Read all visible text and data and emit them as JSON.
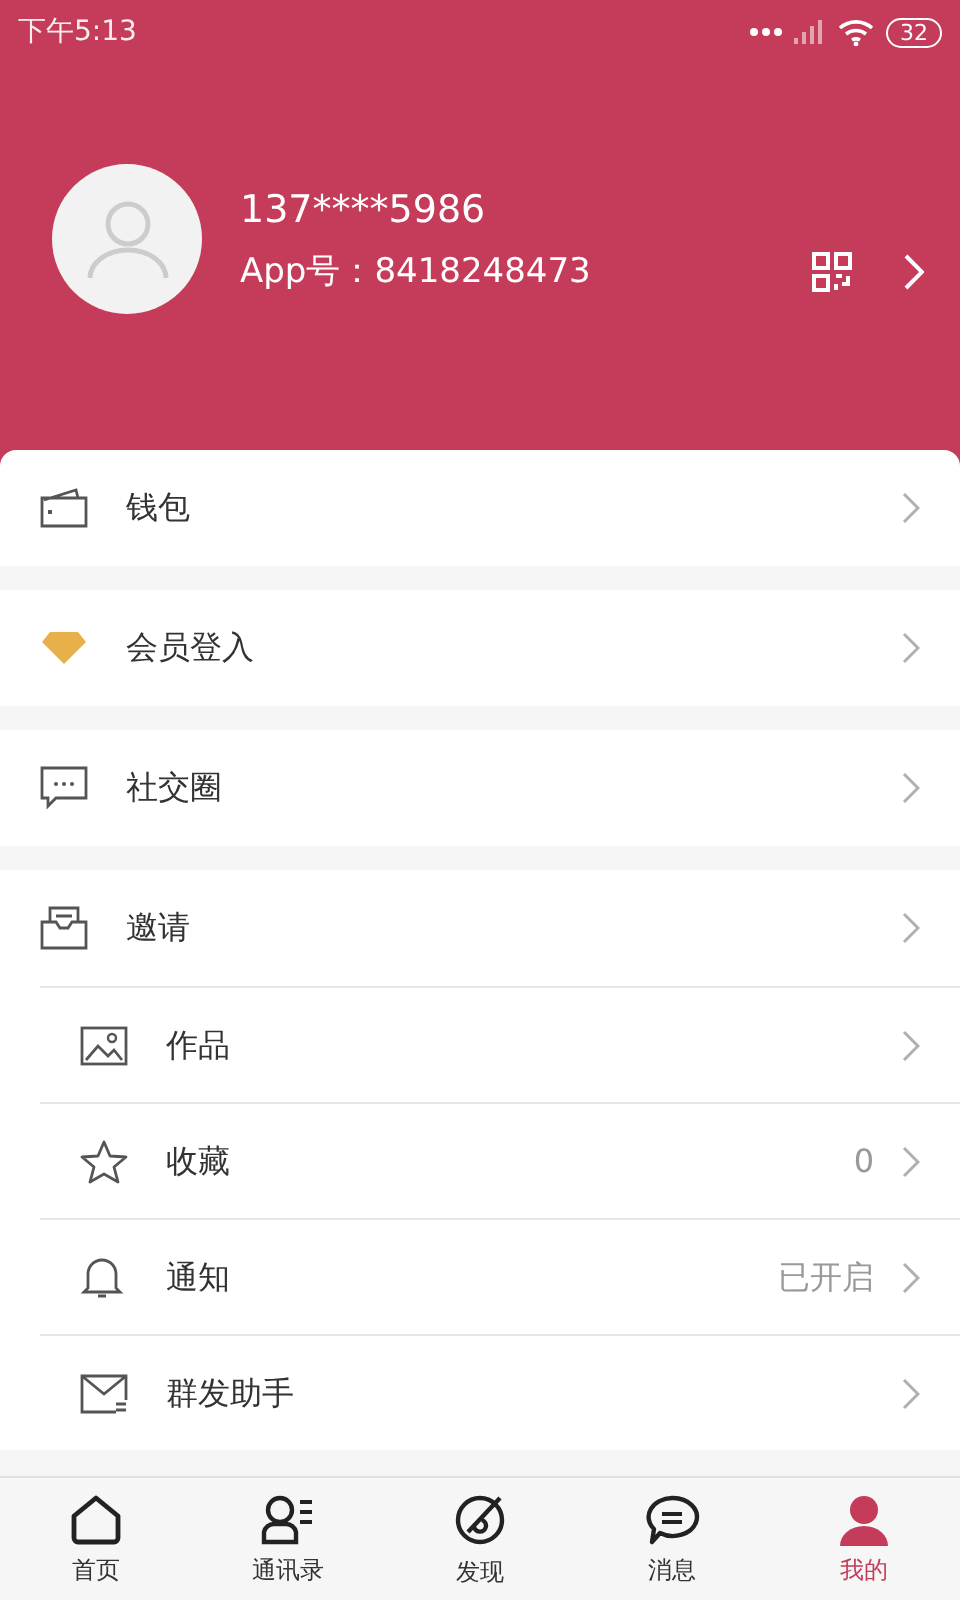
{
  "status_bar": {
    "time": "下午5:13",
    "battery": "32"
  },
  "profile": {
    "phone": "137****5986",
    "app_id": "App号：8418248473"
  },
  "groups": [
    {
      "items": [
        {
          "label": "钱包"
        }
      ]
    },
    {
      "items": [
        {
          "label": "会员登入"
        }
      ]
    },
    {
      "items": [
        {
          "label": "社交圈"
        }
      ]
    },
    {
      "items": [
        {
          "label": "邀请"
        },
        {
          "label": "作品"
        },
        {
          "label": "收藏",
          "value": "0"
        },
        {
          "label": "通知",
          "value": "已开启"
        },
        {
          "label": "群发助手"
        }
      ]
    }
  ],
  "tab_bar": [
    {
      "label": "首页",
      "selected": false
    },
    {
      "label": "通讯录",
      "selected": false
    },
    {
      "label": "发现",
      "selected": false
    },
    {
      "label": "消息",
      "selected": false
    },
    {
      "label": "我的",
      "selected": true
    }
  ]
}
